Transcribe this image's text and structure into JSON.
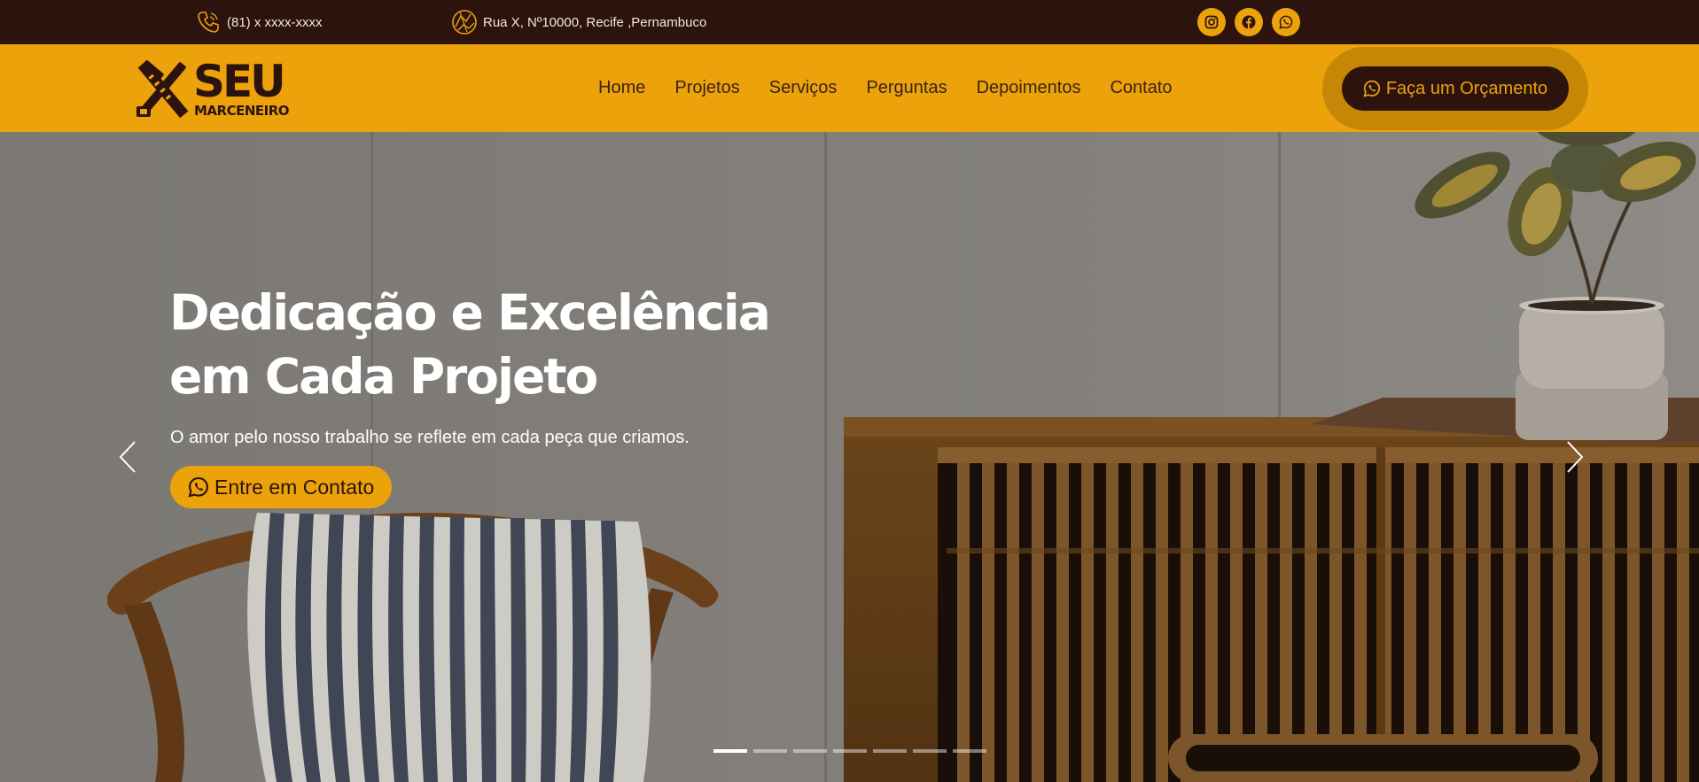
{
  "topbar": {
    "phone": "(81) x xxxx-xxxx",
    "address": "Rua X, Nº10000, Recife ,Pernambuco",
    "socials": [
      {
        "name": "instagram-icon"
      },
      {
        "name": "facebook-icon"
      },
      {
        "name": "whatsapp-icon"
      }
    ]
  },
  "brand": {
    "logo_line1": "SEU",
    "logo_line2": "MARCENEIRO"
  },
  "nav": {
    "items": [
      "Home",
      "Projetos",
      "Serviços",
      "Perguntas",
      "Depoimentos",
      "Contato"
    ],
    "cta_label": "Faça um Orçamento"
  },
  "hero": {
    "title_line1": "Dedicação e Excelência",
    "title_line2": "em Cada Projeto",
    "subtitle": "O amor pelo nosso trabalho se reflete em cada peça que criamos.",
    "button_label": "Entre em Contato",
    "slide_count": 7,
    "active_slide": 1
  },
  "colors": {
    "dark_brown": "#2c130d",
    "amber": "#eba20b",
    "nav_text": "#3b2314"
  }
}
